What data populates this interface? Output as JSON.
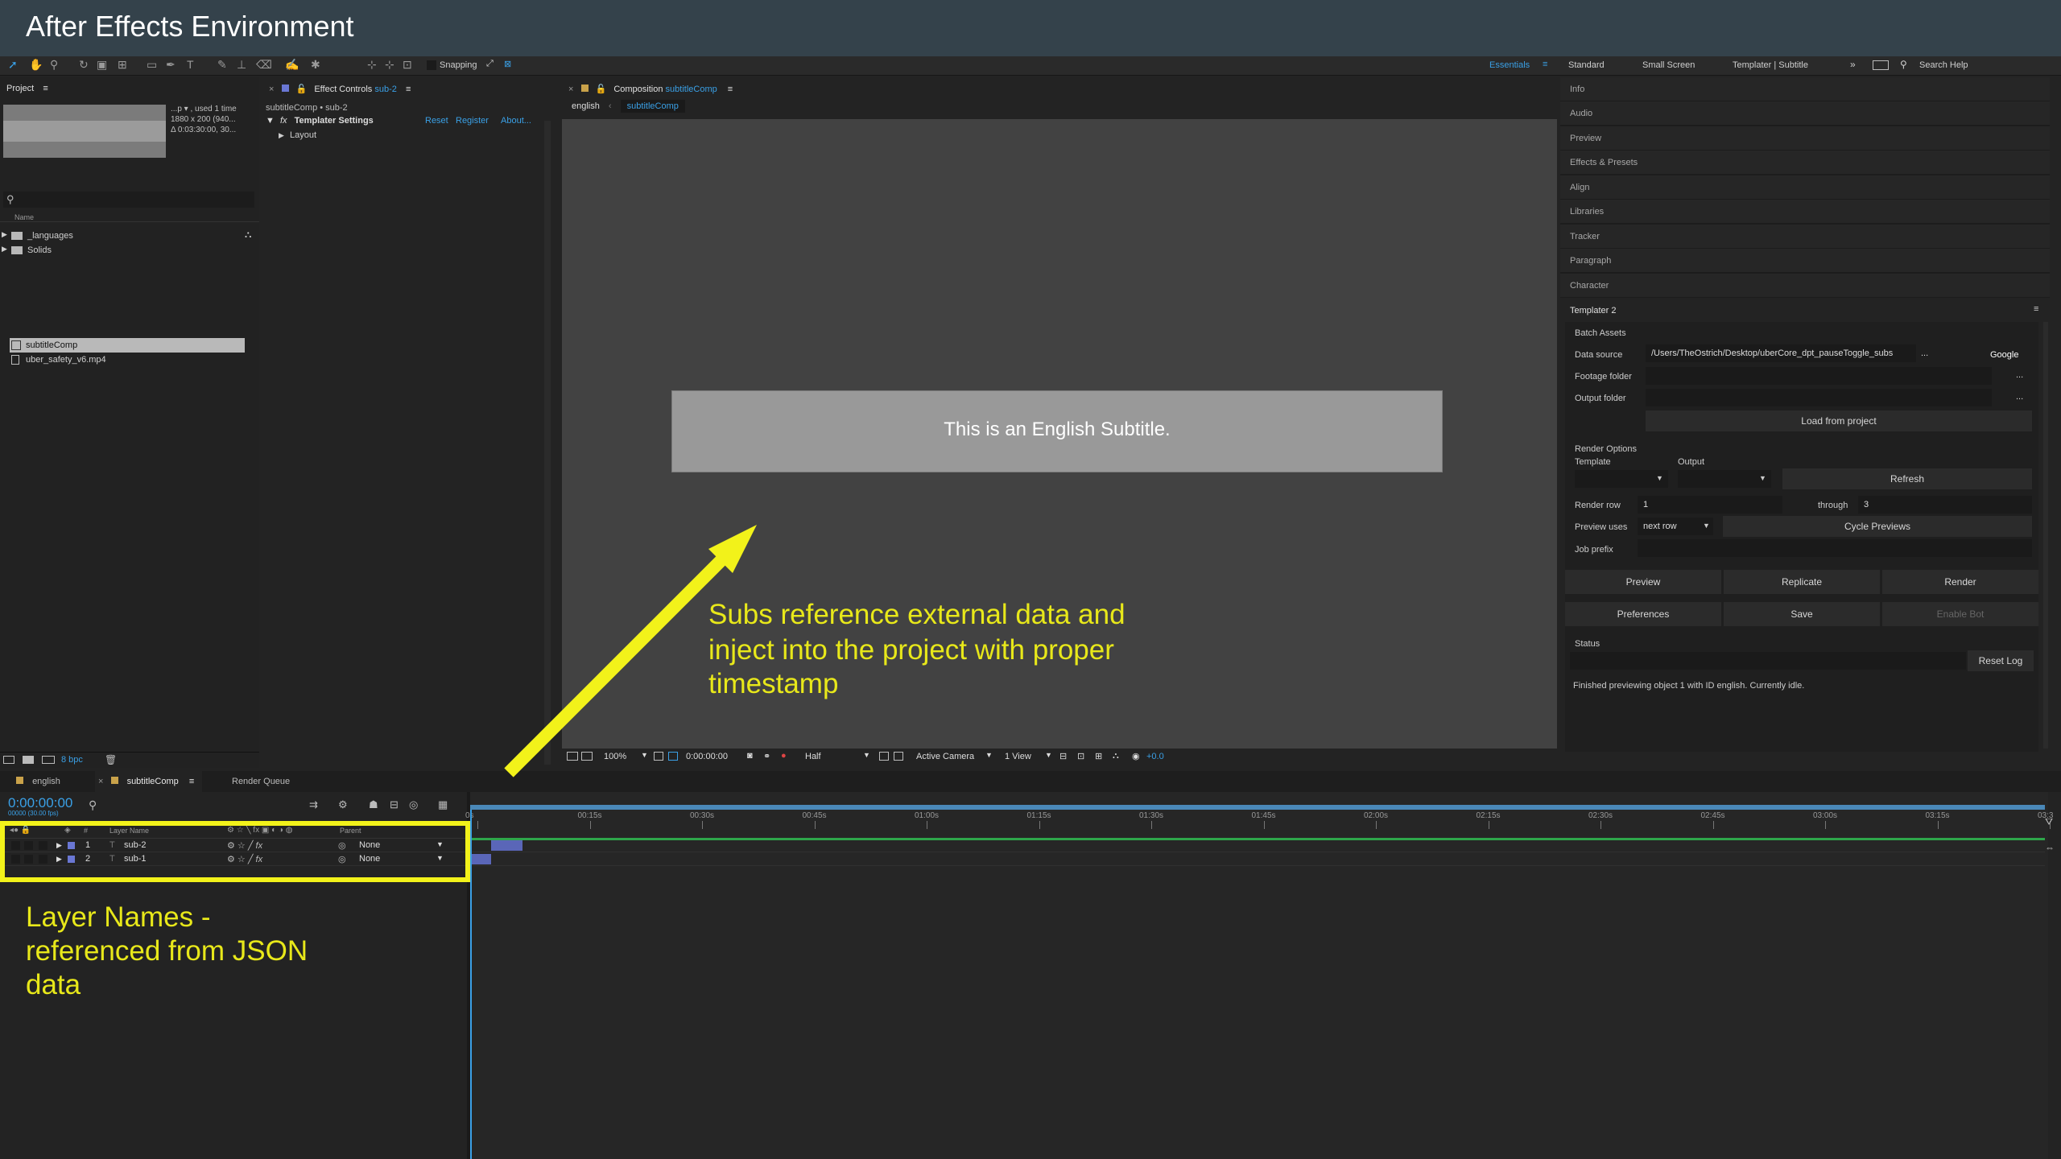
{
  "title_bar": {
    "title": "After Effects Environment"
  },
  "toolbar": {
    "snapping": "Snapping",
    "workspaces": [
      "Essentials",
      "Standard",
      "Small Screen",
      "Templater | Subtitle"
    ],
    "search_help": "Search Help"
  },
  "project": {
    "tab": "Project",
    "info": [
      "...p ▾ , used 1 time",
      "1880 x 200  (940...",
      "Δ 0:03:30:00, 30..."
    ],
    "column_name": "Name",
    "items": [
      "_languages",
      "Solids",
      "subtitleComp",
      "uber_safety_v6.mp4"
    ],
    "bpc": "8 bpc"
  },
  "effect_controls": {
    "tab": "Effect Controls",
    "tab_layer": "sub-2",
    "path": "subtitleComp • sub-2",
    "effect_name": "Templater Settings",
    "links": [
      "Reset",
      "Register",
      "About..."
    ],
    "child": "Layout"
  },
  "composition": {
    "tab": "Composition",
    "tab_comp": "subtitleComp",
    "breadcrumb": [
      "english",
      "subtitleComp"
    ],
    "subtitle": "This is an English Subtitle.",
    "footer": {
      "zoom": "100%",
      "timecode": "0:00:00:00",
      "resolution": "Half",
      "camera": "Active Camera",
      "view": "1 View",
      "exposure": "+0.0"
    }
  },
  "right_panels": [
    "Info",
    "Audio",
    "Preview",
    "Effects & Presets",
    "Align",
    "Libraries",
    "Tracker",
    "Paragraph",
    "Character"
  ],
  "templater": {
    "title": "Templater 2",
    "batch_assets": "Batch Assets",
    "data_source_label": "Data source",
    "data_source_value": "/Users/TheOstrich/Desktop/uberCore_dpt_pauseToggle_subs",
    "ellipsis": "...",
    "google": "Google",
    "footage_folder": "Footage folder",
    "output_folder": "Output folder",
    "load_from_project": "Load from project",
    "render_options": "Render Options",
    "template": "Template",
    "output": "Output",
    "refresh": "Refresh",
    "render_row": "Render row",
    "render_row_value": "1",
    "through": "through",
    "through_value": "3",
    "preview_uses": "Preview uses",
    "preview_uses_value": "next row",
    "cycle_previews": "Cycle Previews",
    "job_prefix": "Job prefix",
    "preview": "Preview",
    "replicate": "Replicate",
    "render": "Render",
    "preferences": "Preferences",
    "save": "Save",
    "enable_bot": "Enable Bot",
    "status": "Status",
    "reset_log": "Reset Log",
    "status_message": "Finished previewing object 1 with ID english.  Currently idle."
  },
  "timeline": {
    "tabs": [
      "english",
      "subtitleComp",
      "Render Queue"
    ],
    "timecode": "0:00:00:00",
    "timecode_sub": "00000 (30.00 fps)",
    "ruler": [
      "0s",
      "00:15s",
      "00:30s",
      "00:45s",
      "01:00s",
      "01:15s",
      "01:30s",
      "01:45s",
      "02:00s",
      "02:15s",
      "02:30s",
      "02:45s",
      "03:00s",
      "03:15s",
      "03:3"
    ],
    "col_layer_name": "Layer Name",
    "col_parent": "Parent",
    "layers": [
      {
        "num": "1",
        "name": "sub-2",
        "parent": "None",
        "bar_start": 0.0135,
        "bar_end": 0.033
      },
      {
        "num": "2",
        "name": "sub-1",
        "parent": "None",
        "bar_start": 0.0,
        "bar_end": 0.0135
      }
    ]
  },
  "annotations": {
    "arrow_note": [
      "Subs reference external data and",
      "inject into the project with proper",
      "timestamp"
    ],
    "layer_note": [
      "Layer Names -",
      "referenced from JSON",
      "data"
    ]
  },
  "colors": {
    "accent": "#3aa0e6",
    "highlight": "#f2f21a",
    "title_bar": "#34424b",
    "label_blue": "#6a77d4"
  }
}
